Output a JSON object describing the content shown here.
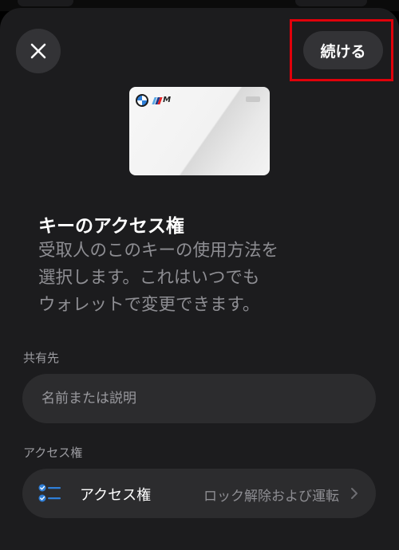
{
  "header": {
    "close_icon": "close-icon",
    "continue_label": "続ける"
  },
  "card": {
    "brand_icon": "bmw-logo-icon",
    "badge_text": "M"
  },
  "intro": {
    "title": "キーのアクセス権",
    "description_lines": [
      "受取人のこのキーの使用方法を",
      "選択します。これはいつでも",
      "ウォレットで変更できます。"
    ]
  },
  "share_to": {
    "label": "共有先",
    "placeholder": "名前または説明",
    "value": ""
  },
  "access": {
    "label": "アクセス権",
    "row_title": "アクセス権",
    "row_value": "ロック解除および運転",
    "icon": "checklist-icon",
    "chevron_icon": "chevron-right-icon"
  },
  "colors": {
    "sheet_bg": "#1c1c1e",
    "control_bg": "#2c2c2e",
    "highlight_border": "#e0000a",
    "accent_blue": "#2f7fd8",
    "secondary_text": "#8e8e93"
  }
}
